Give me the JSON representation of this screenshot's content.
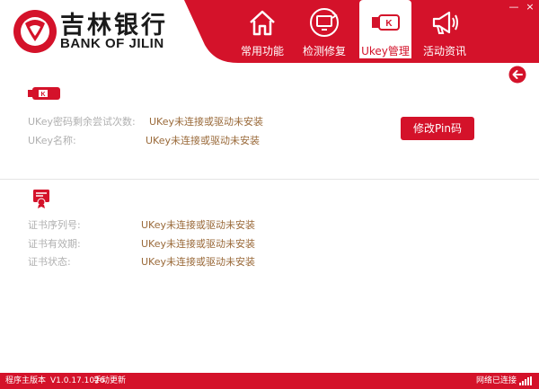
{
  "brand": {
    "name_cn": "吉林银行",
    "name_en": "BANK OF JILIN"
  },
  "window_controls": {
    "minimize": "—",
    "close": "×"
  },
  "tabs": [
    {
      "label": "常用功能",
      "icon": "home-icon",
      "active": false
    },
    {
      "label": "检测修复",
      "icon": "monitor-refresh-icon",
      "active": false
    },
    {
      "label": "Ukey管理",
      "icon": "ukey-icon",
      "active": true
    },
    {
      "label": "活动资讯",
      "icon": "megaphone-icon",
      "active": false
    }
  ],
  "ukey_section": {
    "pin_attempts_label": "UKey密码剩余尝试次数:",
    "pin_attempts_value": "UKey未连接或驱动未安装",
    "name_label": "UKey名称:",
    "name_value": "UKey未连接或驱动未安装",
    "change_pin_button": "修改Pin码"
  },
  "cert_section": {
    "serial_label": "证书序列号:",
    "serial_value": "UKey未连接或驱动未安装",
    "validity_label": "证书有效期:",
    "validity_value": "UKey未连接或驱动未安装",
    "status_label": "证书状态:",
    "status_value": "UKey未连接或驱动未安装"
  },
  "statusbar": {
    "version_label": "程序主版本",
    "version": "V1.0.17.1026",
    "manual_update": "手动更新",
    "network_status": "网络已连接"
  },
  "colors": {
    "brand_red": "#d4122a",
    "value_brown": "#9a6a3a",
    "label_gray": "#b0b0b0"
  }
}
